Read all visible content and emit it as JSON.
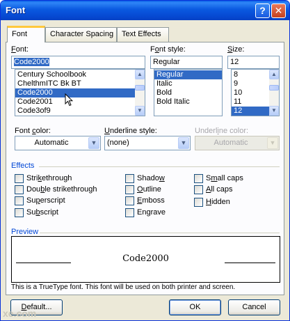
{
  "window": {
    "title": "Font",
    "help_glyph": "?",
    "close_glyph": "✕"
  },
  "tabs": [
    {
      "label": "Font",
      "access_key": "N"
    },
    {
      "label": "Character Spacing",
      "access_key": "R"
    },
    {
      "label": "Text Effects",
      "access_key": "X"
    }
  ],
  "font": {
    "label_pre": "",
    "label_key": "F",
    "label_post": "ont:",
    "value": "Code2000",
    "items": [
      "Century Schoolbook",
      "ChelthmITC Bk BT",
      "Code2000",
      "Code2001",
      "Code3of9"
    ],
    "selected_index": 2
  },
  "style": {
    "label_pre": "F",
    "label_key": "o",
    "label_post": "nt style:",
    "value": "Regular",
    "items": [
      "Regular",
      "Italic",
      "Bold",
      "Bold Italic"
    ],
    "selected_index": 0
  },
  "size": {
    "label_pre": "",
    "label_key": "S",
    "label_post": "ize:",
    "value": "12",
    "items": [
      "8",
      "9",
      "10",
      "11",
      "12"
    ],
    "selected_index": 4
  },
  "font_color": {
    "label_pre": "Font ",
    "label_key": "c",
    "label_post": "olor:",
    "value": "Automatic"
  },
  "underline_style": {
    "label_pre": "",
    "label_key": "U",
    "label_post": "nderline style:",
    "value": "(none)"
  },
  "underline_color": {
    "label_pre": "Underl",
    "label_key": "i",
    "label_post": "ne color:",
    "value": "Automatic"
  },
  "effects": {
    "heading": "Effects",
    "options": [
      {
        "pre": "Stri",
        "key": "k",
        "post": "ethrough",
        "checked": false
      },
      {
        "pre": "Dou",
        "key": "b",
        "post": "le strikethrough",
        "checked": false
      },
      {
        "pre": "Su",
        "key": "p",
        "post": "erscript",
        "checked": false
      },
      {
        "pre": "Su",
        "key": "b",
        "post": "script",
        "checked": false
      },
      {
        "pre": "Shado",
        "key": "w",
        "post": "",
        "checked": false
      },
      {
        "pre": "",
        "key": "O",
        "post": "utline",
        "checked": false
      },
      {
        "pre": "",
        "key": "E",
        "post": "mboss",
        "checked": false
      },
      {
        "pre": "En",
        "key": "g",
        "post": "rave",
        "checked": false
      },
      {
        "pre": "S",
        "key": "m",
        "post": "all caps",
        "checked": false
      },
      {
        "pre": "",
        "key": "A",
        "post": "ll caps",
        "checked": false
      },
      {
        "pre": "",
        "key": "H",
        "post": "idden",
        "checked": false
      }
    ]
  },
  "preview": {
    "heading": "Preview",
    "text": "Code2000"
  },
  "info": "This is a TrueType font. This font will be used on both printer and screen.",
  "buttons": {
    "default": {
      "pre": "",
      "key": "D",
      "post": "efault..."
    },
    "ok": "OK",
    "cancel": "Cancel"
  },
  "watermark": "xe.com",
  "colors": {
    "title_bar": "#0a5fe6",
    "selection": "#316ac5",
    "group_label": "#0046d5",
    "dialog_bg": "#ece9d8"
  }
}
